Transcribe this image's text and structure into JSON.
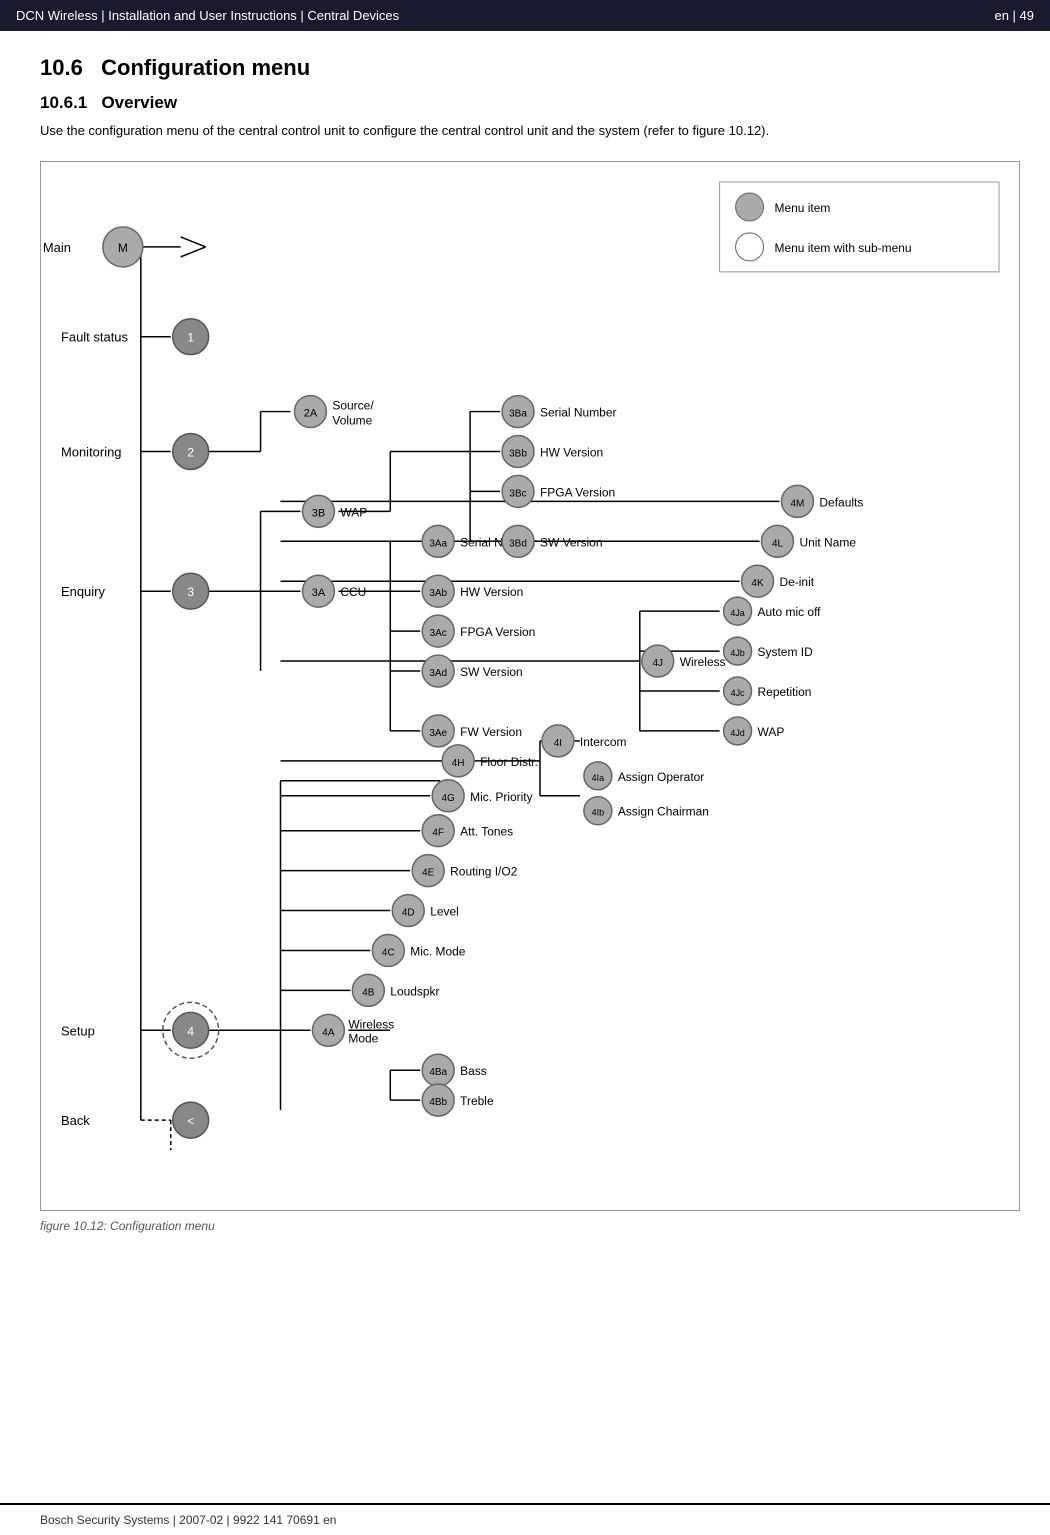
{
  "header": {
    "title": "DCN Wireless | Installation and User Instructions | Central Devices",
    "page": "en | 49"
  },
  "section": {
    "number": "10.6",
    "title": "Configuration menu"
  },
  "subsection": {
    "number": "10.6.1",
    "title": "Overview"
  },
  "intro": "Use the configuration menu of the central control unit to configure the central control unit and the system (refer to figure 10.12).",
  "legend": {
    "item1": "Menu item",
    "item2": "Menu item with sub-menu"
  },
  "figure_caption": "figure 10.12: Configuration menu",
  "footer": "Bosch Security Systems | 2007-02 | 9922 141 70691 en",
  "nodes": {
    "main": "Main",
    "fault_status": "Fault status",
    "monitoring": "Monitoring",
    "enquiry": "Enquiry",
    "setup": "Setup",
    "back": "Back",
    "n1": "1",
    "n2": "2",
    "n3": "3",
    "n4": "4",
    "nback": "<",
    "n2A": "2A",
    "n2A_label": "Source/Volume",
    "n3A": "3A",
    "n3A_label": "CCU",
    "n3B": "3B",
    "n3B_label": "WAP",
    "n3Aa": "3Aa",
    "n3Aa_label": "Serial Number",
    "n3Ab": "3Ab",
    "n3Ab_label": "HW Version",
    "n3Ac": "3Ac",
    "n3Ac_label": "FPGA Version",
    "n3Ad": "3Ad",
    "n3Ad_label": "SW Version",
    "n3Ae": "3Ae",
    "n3Ae_label": "FW Version",
    "n3Ba": "3Ba",
    "n3Ba_label": "Serial Number",
    "n3Bb": "3Bb",
    "n3Bb_label": "HW Version",
    "n3Bc": "3Bc",
    "n3Bc_label": "FPGA Version",
    "n3Bd": "3Bd",
    "n3Bd_label": "SW Version",
    "n4A": "4A",
    "n4A_label": "Wireless Mode",
    "n4B": "4B",
    "n4B_label": "Loudspkr",
    "n4Ba": "4Ba",
    "n4Ba_label": "Bass",
    "n4Bb": "4Bb",
    "n4Bb_label": "Treble",
    "n4C": "4C",
    "n4C_label": "Mic. Mode",
    "n4D": "4D",
    "n4D_label": "Level",
    "n4E": "4E",
    "n4E_label": "Routing I/O2",
    "n4F": "4F",
    "n4F_label": "Att. Tones",
    "n4G": "4G",
    "n4G_label": "Mic. Priority",
    "n4H": "4H",
    "n4H_label": "Floor Distr.",
    "n4I": "4I",
    "n4I_label": "Intercom",
    "n4Ia": "4Ia",
    "n4Ia_label": "Assign Operator",
    "n4Ib": "4Ib",
    "n4Ib_label": "Assign Chairman",
    "n4J": "4J",
    "n4J_label": "Wireless",
    "n4Ja": "4Ja",
    "n4Ja_label": "Auto mic off",
    "n4Jb": "4Jb",
    "n4Jb_label": "System ID",
    "n4Jc": "4Jc",
    "n4Jc_label": "Repetition",
    "n4Jd": "4Jd",
    "n4Jd_label": "WAP",
    "n4K": "4K",
    "n4K_label": "De-init",
    "n4L": "4L",
    "n4L_label": "Unit Name",
    "n4M": "4M",
    "n4M_label": "Defaults"
  }
}
